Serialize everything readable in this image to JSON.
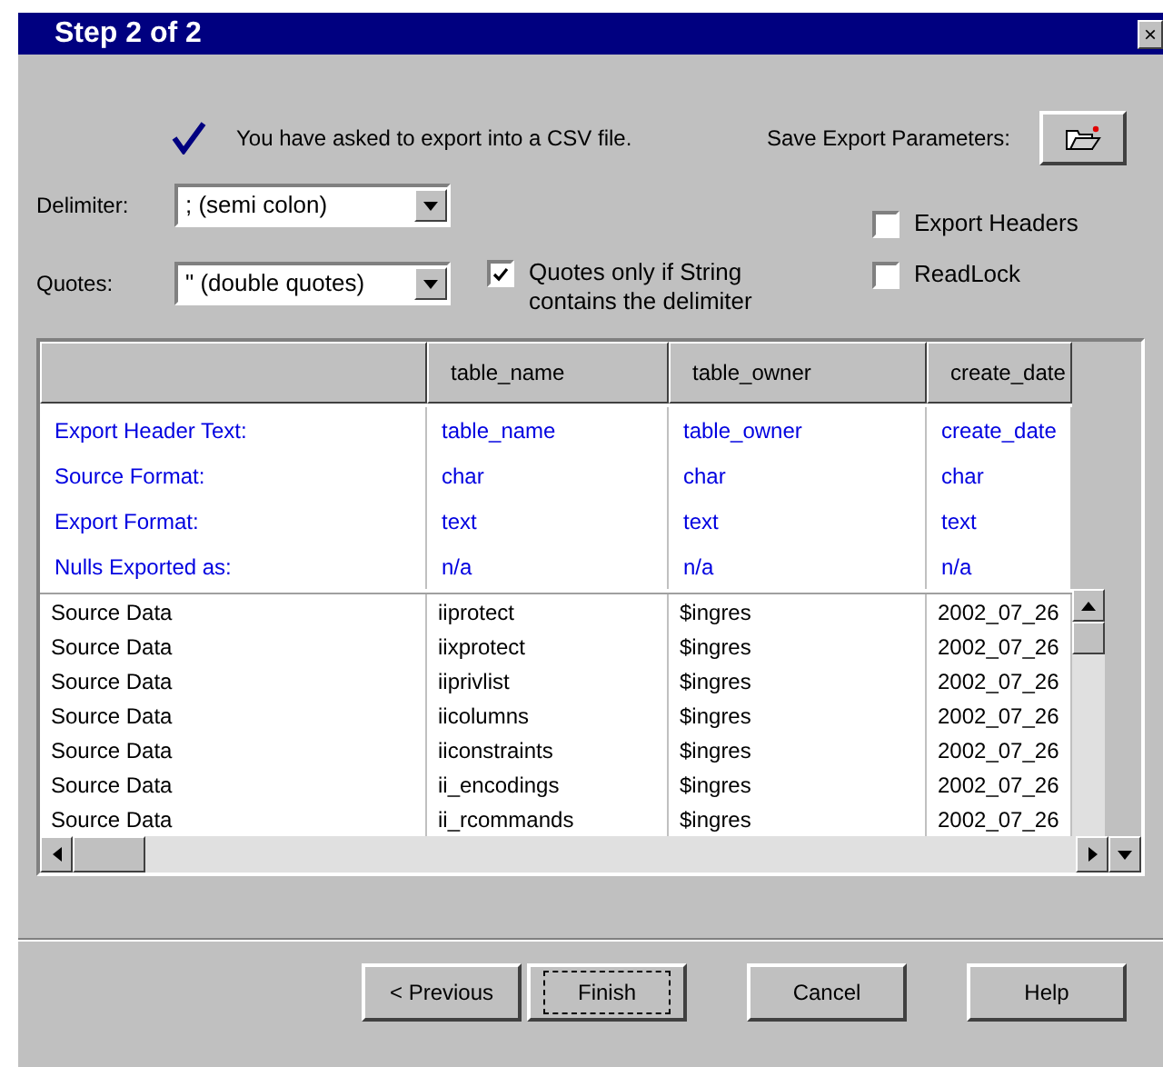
{
  "window": {
    "title": "Step 2 of 2",
    "close": "×"
  },
  "message": "You have asked to export into a CSV file.",
  "save_params": {
    "label": "Save Export Parameters:"
  },
  "delimiter": {
    "label": "Delimiter:",
    "value": "; (semi colon)"
  },
  "quotes": {
    "label": "Quotes:",
    "value": "\" (double quotes)"
  },
  "quote_only_if_string": {
    "label": "Quotes only if String contains the delimiter",
    "checked": true
  },
  "options": [
    {
      "label": "Export Headers",
      "checked": false
    },
    {
      "label": "ReadLock",
      "checked": false
    }
  ],
  "table": {
    "columns": [
      "",
      "table_name",
      "table_owner",
      "create_date"
    ],
    "settings_rows": [
      [
        "Export Header Text:",
        "table_name",
        "table_owner",
        "create_date"
      ],
      [
        "Source Format:",
        "char",
        "char",
        "char"
      ],
      [
        "Export Format:",
        "text",
        "text",
        "text"
      ],
      [
        "Nulls Exported as:",
        "n/a",
        "n/a",
        "n/a"
      ]
    ],
    "data_rows": [
      [
        "Source Data",
        "iiprotect",
        "$ingres",
        "2002_07_26"
      ],
      [
        "Source Data",
        "iixprotect",
        "$ingres",
        "2002_07_26"
      ],
      [
        "Source Data",
        "iiprivlist",
        "$ingres",
        "2002_07_26"
      ],
      [
        "Source Data",
        "iicolumns",
        "$ingres",
        "2002_07_26"
      ],
      [
        "Source Data",
        "iiconstraints",
        "$ingres",
        "2002_07_26"
      ],
      [
        "Source Data",
        "ii_encodings",
        "$ingres",
        "2002_07_26"
      ],
      [
        "Source Data",
        "ii_rcommands",
        "$ingres",
        "2002_07_26"
      ]
    ]
  },
  "buttons": [
    {
      "label": "< Previous",
      "default": false
    },
    {
      "label": "Finish",
      "default": true
    },
    {
      "label": "Cancel",
      "default": false
    },
    {
      "label": "Help",
      "default": false
    }
  ]
}
